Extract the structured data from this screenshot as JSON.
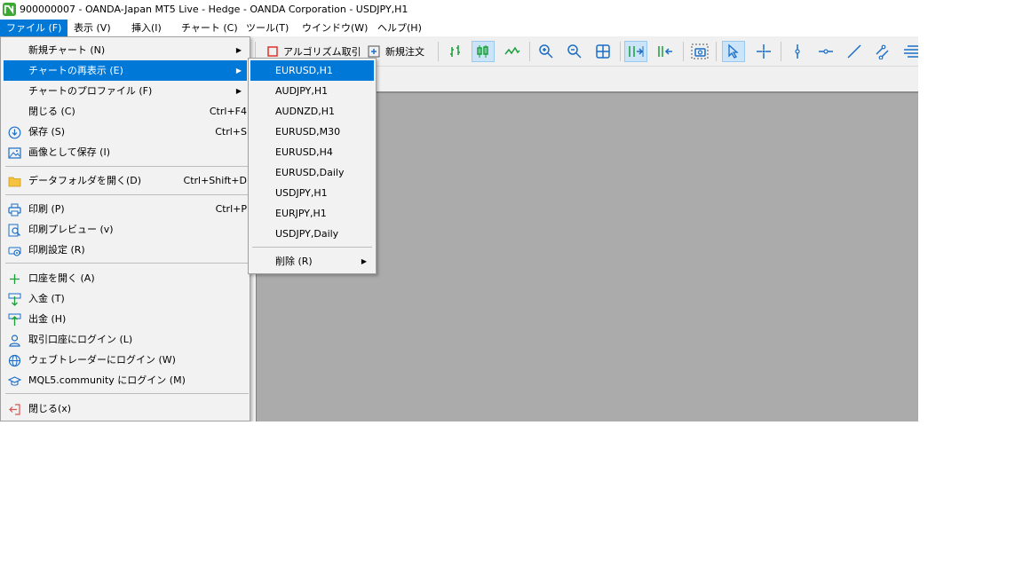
{
  "window": {
    "title": "900000007 - OANDA-Japan MT5 Live - Hedge - OANDA Corporation - USDJPY,H1"
  },
  "menubar": [
    {
      "label": "ファイル (F)"
    },
    {
      "label": "表示 (V)"
    },
    {
      "label": "挿入(I)"
    },
    {
      "label": "チャート (C)"
    },
    {
      "label": "ツール(T)"
    },
    {
      "label": "ウインドウ(W)"
    },
    {
      "label": "ヘルプ(H)"
    }
  ],
  "toolbar": {
    "algo_trading_label": "アルゴリズム取引",
    "new_order_label": "新規注文"
  },
  "file_menu": {
    "items": [
      {
        "label": "新規チャート (N)",
        "shortcut": "",
        "arrow": "▶",
        "icon": "none"
      },
      {
        "label": "チャートの再表示 (E)",
        "shortcut": "",
        "arrow": "▶",
        "icon": "none"
      },
      {
        "label": "チャートのプロファイル (F)",
        "shortcut": "",
        "arrow": "▶",
        "icon": "none"
      },
      {
        "label": "閉じる (C)",
        "shortcut": "Ctrl+F4",
        "arrow": "",
        "icon": "none"
      },
      {
        "label": "保存 (S)",
        "shortcut": "Ctrl+S",
        "arrow": "",
        "icon": "save-icon"
      },
      {
        "label": "画像として保存 (I)",
        "shortcut": "",
        "arrow": "",
        "icon": "image-icon"
      },
      {
        "label": "データフォルダを開く(D)",
        "shortcut": "Ctrl+Shift+D",
        "arrow": "",
        "icon": "folder-icon"
      },
      {
        "label": "印刷 (P)",
        "shortcut": "Ctrl+P",
        "arrow": "",
        "icon": "printer-icon"
      },
      {
        "label": "印刷プレビュー (v)",
        "shortcut": "",
        "arrow": "",
        "icon": "print-preview-icon"
      },
      {
        "label": "印刷設定 (R)",
        "shortcut": "",
        "arrow": "",
        "icon": "print-settings-icon"
      },
      {
        "label": "口座を開く (A)",
        "shortcut": "",
        "arrow": "",
        "icon": "plus-icon"
      },
      {
        "label": "入金 (T)",
        "shortcut": "",
        "arrow": "",
        "icon": "deposit-icon"
      },
      {
        "label": "出金 (H)",
        "shortcut": "",
        "arrow": "",
        "icon": "withdraw-icon"
      },
      {
        "label": "取引口座にログイン (L)",
        "shortcut": "",
        "arrow": "",
        "icon": "user-icon"
      },
      {
        "label": "ウェブトレーダーにログイン (W)",
        "shortcut": "",
        "arrow": "",
        "icon": "globe-icon"
      },
      {
        "label": "MQL5.community にログイン (M)",
        "shortcut": "",
        "arrow": "",
        "icon": "graduation-cap-icon"
      },
      {
        "label": "閉じる(x)",
        "shortcut": "",
        "arrow": "",
        "icon": "exit-icon"
      }
    ]
  },
  "reopen_submenu": {
    "items": [
      {
        "label": "EURUSD,H1"
      },
      {
        "label": "AUDJPY,H1"
      },
      {
        "label": "AUDNZD,H1"
      },
      {
        "label": "EURUSD,M30"
      },
      {
        "label": "EURUSD,H4"
      },
      {
        "label": "EURUSD,Daily"
      },
      {
        "label": "USDJPY,H1"
      },
      {
        "label": "EURJPY,H1"
      },
      {
        "label": "USDJPY,Daily"
      }
    ],
    "delete_label": "削除 (R)",
    "delete_arrow": "▶"
  },
  "colors": {
    "highlight": "#0078d7",
    "chart_background": "#ababab",
    "icon_green": "#1a9e3a",
    "icon_blue": "#1a6ec8",
    "logo_green": "#3aa832"
  }
}
